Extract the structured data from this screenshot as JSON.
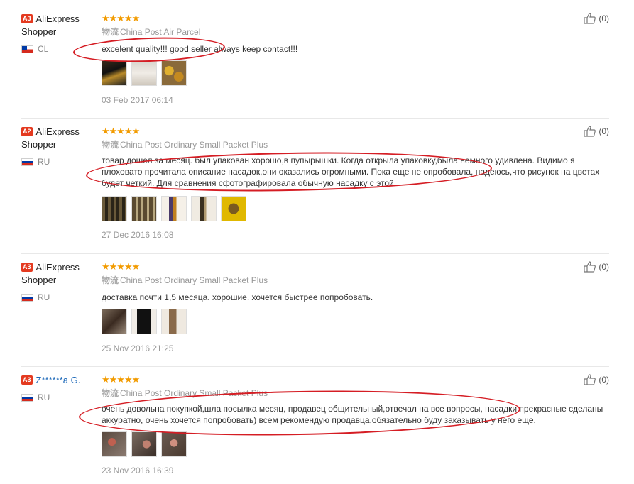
{
  "colors": {
    "star": "#f29b00",
    "badge": "#e43a20",
    "oval": "#d51d24",
    "link": "#1a67b8"
  },
  "reviews": [
    {
      "level": "A3",
      "user": "AliExpress Shopper",
      "country": "CL",
      "stars": "★★★★★",
      "shipping_icon": "物流",
      "shipping": "China Post Air Parcel",
      "text": "excelent quality!!! good seller always keep contact!!!",
      "date": "03 Feb 2017 06:14",
      "helpful": "(0)"
    },
    {
      "level": "A2",
      "user": "AliExpress Shopper",
      "country": "RU",
      "stars": "★★★★★",
      "shipping_icon": "物流",
      "shipping": "China Post Ordinary Small Packet Plus",
      "text": "товар дошел за месяц. был упакован хорошо,в пупырышки. Когда открыла упаковку,была немного удивлена. Видимо я плоховато прочитала описание насадок,они оказались огромными. Пока еще не опробовала, надеюсь,что рисунок на цветах будет четкий. Для сравнения сфотографировала обычную насадку с этой.",
      "date": "27 Dec 2016 16:08",
      "helpful": "(0)"
    },
    {
      "level": "A3",
      "user": "AliExpress Shopper",
      "country": "RU",
      "stars": "★★★★★",
      "shipping_icon": "物流",
      "shipping": "China Post Ordinary Small Packet Plus",
      "text": "доставка почти 1,5 месяца. хорошие. хочется быстрее попробовать.",
      "date": "25 Nov 2016 21:25",
      "helpful": "(0)"
    },
    {
      "level": "A3",
      "user": "Z******a G.",
      "country": "RU",
      "stars": "★★★★★",
      "shipping_icon": "物流",
      "shipping": "China Post Ordinary Small Packet Plus",
      "text": "очень довольна покупкой,шла посылка месяц, продавец общительный,отвечал на все вопросы, насадки прекрасные сделаны аккуратно, очень хочется попробовать) всем рекомендую продавца,обязательно буду заказывать у него еще.",
      "date": "23 Nov 2016 16:39",
      "helpful": "(0)"
    }
  ]
}
